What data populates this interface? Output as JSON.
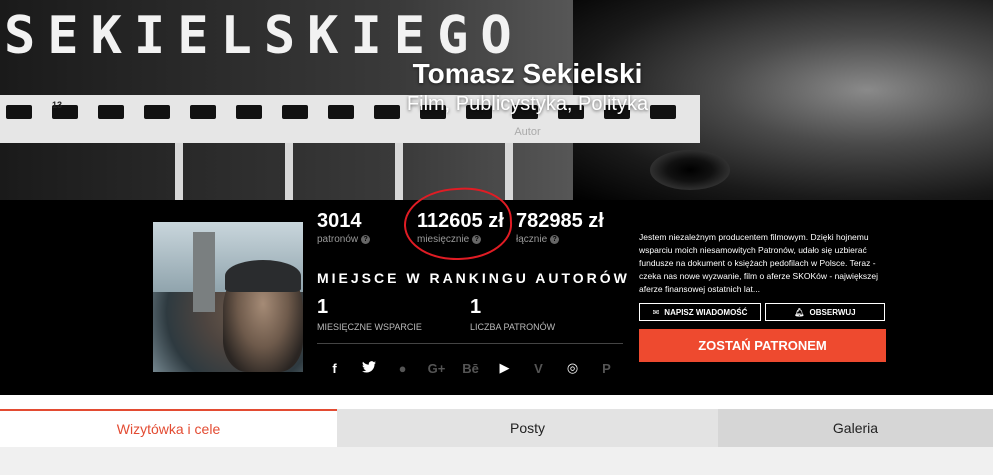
{
  "banner": {
    "title": "SEKIELSKIEGO",
    "name": "Tomasz Sekielski",
    "categories": "Film, Publicystyka, Polityka",
    "role": "Autor",
    "film_number": "13"
  },
  "stats": {
    "patrons": {
      "value": "3014",
      "label": "patronów"
    },
    "monthly": {
      "value": "112605 zł",
      "label": "miesięcznie"
    },
    "total": {
      "value": "782985 zł",
      "label": "łącznie"
    }
  },
  "ranking": {
    "title": "MIEJSCE W RANKINGU AUTORÓW",
    "monthly_value": "1",
    "monthly_label": "MIESIĘCZNE WSPARCIE",
    "patrons_value": "1",
    "patrons_label": "LICZBA PATRONÓW"
  },
  "social": [
    {
      "icon": "facebook-icon",
      "glyph": "f"
    },
    {
      "icon": "twitter-icon",
      "glyph": "🐦"
    },
    {
      "icon": "globe-icon",
      "glyph": "●"
    },
    {
      "icon": "google-plus-icon",
      "glyph": "G+"
    },
    {
      "icon": "behance-icon",
      "glyph": "Bē"
    },
    {
      "icon": "youtube-icon",
      "glyph": "▶"
    },
    {
      "icon": "vimeo-icon",
      "glyph": "V"
    },
    {
      "icon": "instagram-icon",
      "glyph": "◎"
    },
    {
      "icon": "pinterest-icon",
      "glyph": "P"
    }
  ],
  "about": "Jestem niezależnym producentem filmowym. Dzięki hojnemu wsparciu moich niesamowitych Patronów, udało się uzbierać fundusze na dokument o księżach pedofilach w Polsce. Teraz - czeka nas nowe wyzwanie, film o aferze SKOKów - największej aferze finansowej ostatnich lat...",
  "buttons": {
    "message": "NAPISZ WIADOMOŚĆ",
    "follow": "OBSERWUJ",
    "become_patron": "ZOSTAŃ PATRONEM"
  },
  "tabs": [
    {
      "label": "Wizytówka i cele",
      "active": true
    },
    {
      "label": "Posty",
      "active": false
    },
    {
      "label": "Galeria",
      "active": false
    }
  ],
  "colors": {
    "accent": "#ee4a2f",
    "annotation": "#e01c24"
  }
}
